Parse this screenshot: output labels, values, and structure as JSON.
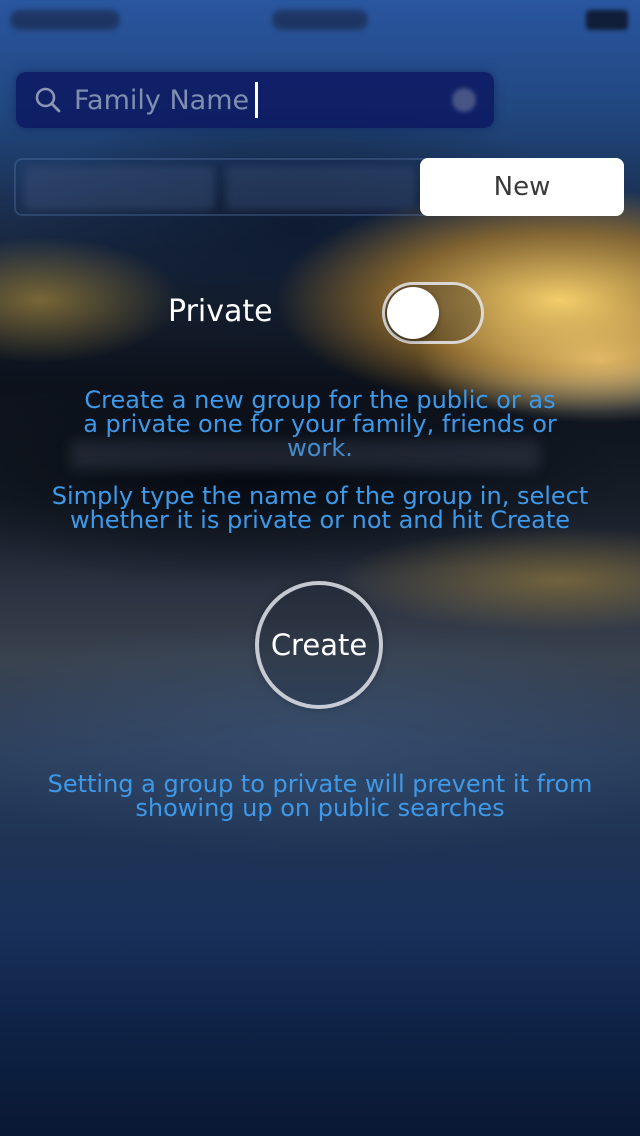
{
  "search": {
    "value": "Family Name",
    "icon": "search-icon"
  },
  "segments": {
    "new_label": "New"
  },
  "form": {
    "private_label": "Private",
    "private_enabled": false
  },
  "info": {
    "description_1": "Create a new group for the public or as a private one for your family, friends or work.",
    "description_2": "Simply type the name of the group in, select whether it is private or not and hit Create",
    "private_note": "Setting a group to private will prevent it from showing up on public searches"
  },
  "actions": {
    "create_label": "Create"
  },
  "colors": {
    "accent_blue": "#3e99e8",
    "search_bar": "#0a145f",
    "white": "#ffffff"
  }
}
